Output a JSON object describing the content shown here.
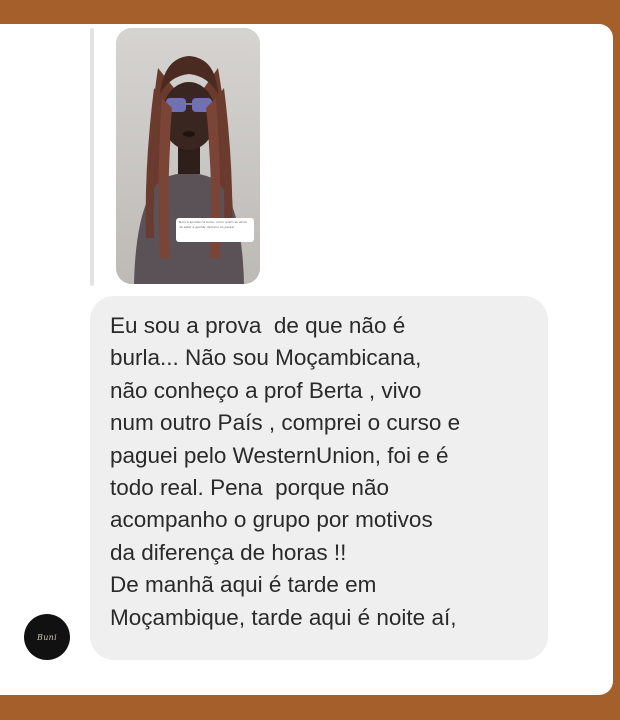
{
  "story": {
    "caption": "Nunca apostei na burla, como quem se alivia de estar a ganhar dinheiro ao passar",
    "image_description": "story-photo-person"
  },
  "message": {
    "lines": [
      "Eu sou a prova  de que não é",
      "burla... Não sou Moçambicana,",
      "não conheço a prof Berta , vivo",
      "num outro País , comprei o curso e",
      "paguei pelo WesternUnion, foi e é",
      "todo real. Pena  porque não",
      "acompanho o grupo por motivos",
      "da diferença de horas !!",
      "De manhã aqui é tarde em",
      "Moçambique, tarde aqui é noite aí,"
    ]
  },
  "sender": {
    "avatar_text": "Buni"
  },
  "colors": {
    "frame": "#a45f2a",
    "bubble": "#efefef",
    "text": "#2a2a2a"
  }
}
